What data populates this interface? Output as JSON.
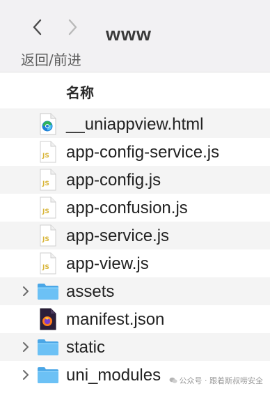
{
  "toolbar": {
    "title": "www",
    "nav_caption": "返回/前进"
  },
  "header": {
    "name_column": "名称"
  },
  "files": [
    {
      "name": "__uniappview.html",
      "icon": "html-file-icon",
      "expandable": false
    },
    {
      "name": "app-config-service.js",
      "icon": "js-file-icon",
      "expandable": false
    },
    {
      "name": "app-config.js",
      "icon": "js-file-icon",
      "expandable": false
    },
    {
      "name": "app-confusion.js",
      "icon": "js-file-icon",
      "expandable": false
    },
    {
      "name": "app-service.js",
      "icon": "js-file-icon",
      "expandable": false
    },
    {
      "name": "app-view.js",
      "icon": "js-file-icon",
      "expandable": false
    },
    {
      "name": "assets",
      "icon": "folder-icon",
      "expandable": true
    },
    {
      "name": "manifest.json",
      "icon": "json-file-icon",
      "expandable": false
    },
    {
      "name": "static",
      "icon": "folder-icon",
      "expandable": true
    },
    {
      "name": "uni_modules",
      "icon": "folder-icon",
      "expandable": true
    }
  ],
  "watermark": "公众号 · 跟着斯叔唠安全",
  "colors": {
    "toolbar_bg": "#f2f1f3",
    "stripe_bg": "#f4f4f4",
    "folder_blue": "#5ab4ee",
    "js_yellow": "#d9b63a"
  }
}
